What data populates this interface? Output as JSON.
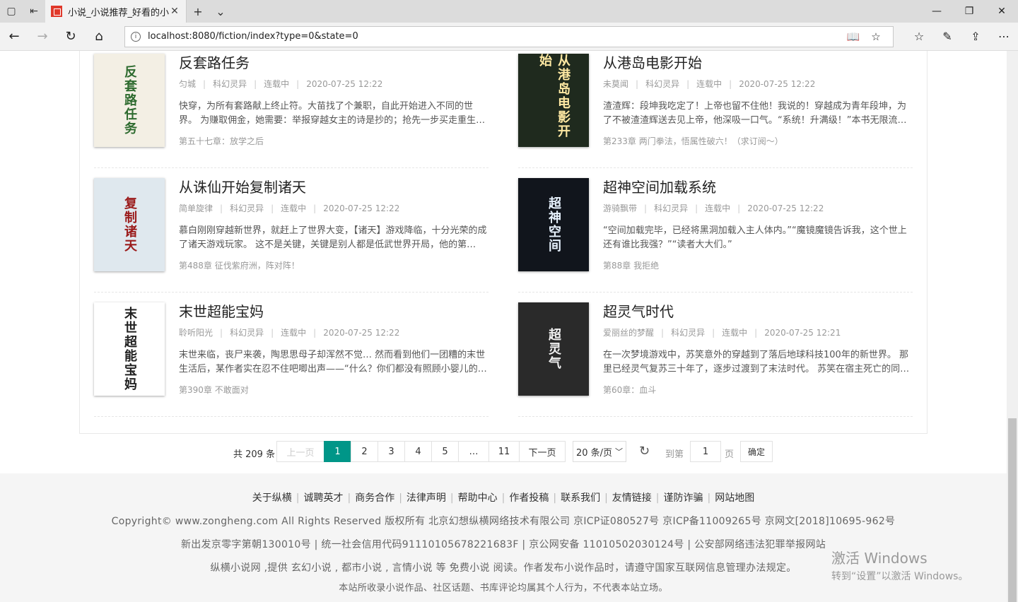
{
  "browser": {
    "tab_title": "小说_小说推荐_好看的小说",
    "url": "localhost:8080/fiction/index?type=0&state=0"
  },
  "books": [
    {
      "name": "反套路任务",
      "cover_text": "反套路任务",
      "cover_bg": "#f3efe4",
      "cover_fg": "#2e6b2f",
      "author": "匀城",
      "genre": "科幻灵异",
      "status": "连载中",
      "time": "2020-07-25 12:22",
      "desc": "快穿，为所有套路献上终止符。大苗找了个兼职，自此开始进入不同的世界。 为赚取佣金，她需要：举报穿越女主的诗是抄的；抢先一步买走重生…",
      "chapter": "第五十七章：放学之后"
    },
    {
      "name": "从港岛电影开始",
      "cover_text": "从港岛电影开始",
      "cover_bg": "#1f2a1e",
      "cover_fg": "#ffe9a3",
      "author": "未莫闻",
      "genre": "科幻灵异",
      "status": "连载中",
      "time": "2020-07-25 12:22",
      "desc": "渣渣辉：段坤我吃定了！上帝也留不住他！我说的！穿越成为青年段坤，为了不被渣渣辉送去见上帝，他深吸一口气。“系统！升满级！”本书无限流…",
      "chapter": "第233章 两门拳法，悟属性破六！（求订阅～）"
    },
    {
      "name": "从诛仙开始复制诸天",
      "cover_text": "复制诸天",
      "cover_bg": "#dfe8ee",
      "cover_fg": "#9b1c1c",
      "author": "简单旋律",
      "genre": "科幻灵异",
      "status": "连载中",
      "time": "2020-07-25 12:22",
      "desc": "慕白刚刚穿越新世界，就赶上了世界大变，【诸天】游戏降临，十分光荣的成了诸天游戏玩家。 这不是关键，关键是别人都是低武世界开局，他的第…",
      "chapter": "第488章 征伐紫府洲，阵对阵！"
    },
    {
      "name": "超神空间加载系统",
      "cover_text": "超神空间",
      "cover_bg": "#11151c",
      "cover_fg": "#e8f3ff",
      "author": "游骑飘带",
      "genre": "科幻灵异",
      "status": "连载中",
      "time": "2020-07-25 12:22",
      "desc": "“空间加载完毕，已经将黑洞加载入主人体内。”“魔镜魔镜告诉我，这个世上还有谁比我强？”“读者大大们。”",
      "chapter": "第88章 我拒绝"
    },
    {
      "name": "末世超能宝妈",
      "cover_text": "末世超能宝妈",
      "cover_bg": "#ffffff",
      "cover_fg": "#222222",
      "author": "聆听阳光",
      "genre": "科幻灵异",
      "status": "连载中",
      "time": "2020-07-25 12:22",
      "desc": "末世来临，丧尸来袭，陶思思母子却浑然不觉… 然而看到他们一团糟的末世生活后，某作者实在忍不住吧唧出声——“什么？你们都没有照顾小婴儿的…",
      "chapter": "第390章 不敢面对"
    },
    {
      "name": "超灵气时代",
      "cover_text": "超灵气",
      "cover_bg": "#2a2a2a",
      "cover_fg": "#f0f0f0",
      "author": "爱丽丝的梦醒",
      "genre": "科幻灵异",
      "status": "连载中",
      "time": "2020-07-25 12:21",
      "desc": "在一次梦境游戏中，苏笑意外的穿越到了落后地球科技100年的新世界。 那里已经灵气复苏三十年了，逐步过渡到了末法时代。 苏笑在宿主死亡的同…",
      "chapter": "第60章：血斗"
    }
  ],
  "pager": {
    "total": "共 209 条",
    "prev": "上一页",
    "pages": [
      "1",
      "2",
      "3",
      "4",
      "5",
      "…",
      "11"
    ],
    "next": "下一页",
    "size": "20 条/页",
    "goto_label": "到第",
    "goto_value": "1",
    "page_label": "页",
    "confirm": "确定"
  },
  "footer": {
    "links": [
      "关于纵横",
      "诚聘英才",
      "商务合作",
      "法律声明",
      "帮助中心",
      "作者投稿",
      "联系我们",
      "友情链接",
      "谨防诈骗",
      "网站地图"
    ],
    "line1": "Copyright© www.zongheng.com All Rights Reserved 版权所有 北京幻想纵横网络技术有限公司  京ICP证080527号   京ICP备11009265号   京网文[2018]10695-962号",
    "line2": "新出发京零字第朝130010号   |   统一社会信用代码91110105678221683F   |   京公网安备 11010502030124号   |   公安部网络违法犯罪举报网站",
    "line3": "纵横小说网 ,提供 玄幻小说 , 都市小说 , 言情小说 等 免费小说 阅读。作者发布小说作品时，请遵守国家互联网信息管理办法规定。",
    "line4": "本站所收录小说作品、社区话题、书库评论均属其个人行为，不代表本站立场。"
  },
  "watermark": {
    "line1": "激活 Windows",
    "line2": "转到“设置”以激活 Windows。"
  }
}
